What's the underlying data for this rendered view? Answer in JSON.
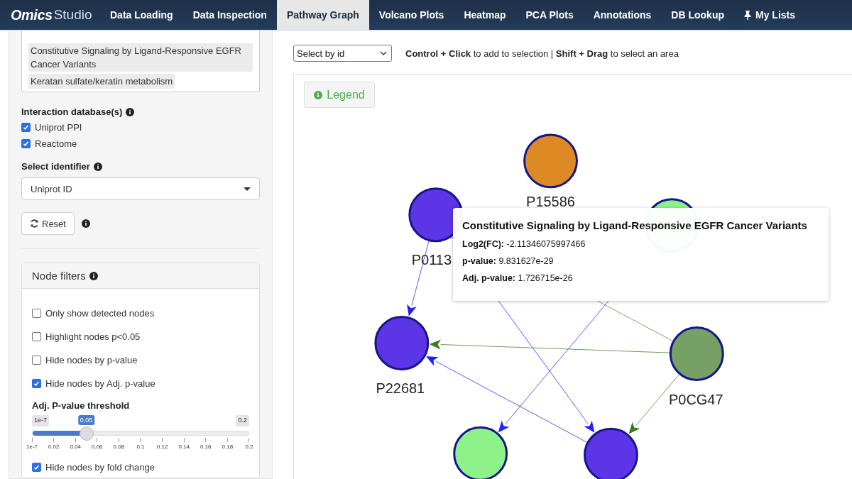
{
  "nav": {
    "logo": {
      "bold": "Omics",
      "light": "Studio"
    },
    "tabs": [
      {
        "label": "Data Loading",
        "selected": false,
        "pinned": false
      },
      {
        "label": "Data Inspection",
        "selected": false,
        "pinned": false
      },
      {
        "label": "Pathway Graph",
        "selected": true,
        "pinned": false
      },
      {
        "label": "Volcano Plots",
        "selected": false,
        "pinned": false
      },
      {
        "label": "Heatmap",
        "selected": false,
        "pinned": false
      },
      {
        "label": "PCA Plots",
        "selected": false,
        "pinned": false
      },
      {
        "label": "Annotations",
        "selected": false,
        "pinned": false
      },
      {
        "label": "DB Lookup",
        "selected": false,
        "pinned": false
      },
      {
        "label": "My Lists",
        "selected": false,
        "pinned": true
      }
    ]
  },
  "sidebar": {
    "pathways": [
      {
        "label": "Constitutive Signaling by Ligand-Responsive EGFR Cancer Variants",
        "selected": true
      },
      {
        "label": "Keratan sulfate/keratin metabolism",
        "selected": true
      }
    ],
    "databases": {
      "label": "Interaction database(s)",
      "options": [
        {
          "label": "Uniprot PPI",
          "checked": true
        },
        {
          "label": "Reactome",
          "checked": true
        }
      ]
    },
    "identifier": {
      "label": "Select identifier",
      "value": "Uniprot ID"
    },
    "reset": "Reset",
    "node_filters": {
      "title": "Node filters",
      "checkboxes": [
        {
          "label": "Only show detected nodes",
          "checked": false
        },
        {
          "label": "Highlight nodes p<0.05",
          "checked": false
        },
        {
          "label": "Hide nodes by p-value",
          "checked": false
        },
        {
          "label": "Hide nodes by Adj. p-value",
          "checked": true
        }
      ],
      "slider": {
        "label": "Adj. P-value threshold",
        "min": "1e-7",
        "max": "0.2",
        "value": "0.05",
        "level": 0.25,
        "ticks": [
          "1e-7",
          "0.02",
          "0.04",
          "0.06",
          "0.08",
          "0.1",
          "0.12",
          "0.14",
          "0.16",
          "0.18",
          "0.2"
        ]
      },
      "after": [
        {
          "label": "Hide nodes by fold change",
          "checked": true
        }
      ]
    }
  },
  "main": {
    "select": "Select by id",
    "hint": "**Control + Click** to add to selection | **Shift + Drag** to select an area",
    "legend": "Legend",
    "graph": {
      "nodes": [
        {
          "label": "P15586",
          "color": "#dd8a25"
        },
        {
          "label": "P0113",
          "color": "#5b35e6"
        },
        {
          "color": "#8ef28a"
        },
        {
          "label": "P22681",
          "color": "#5b35e6"
        },
        {
          "label": "P0CG47",
          "color": "#77a065"
        },
        {
          "color": "#8ef28a"
        },
        {
          "color": "#5b35e6"
        }
      ],
      "tooltip": {
        "title": "Constitutive Signaling by Ligand-Responsive EGFR Cancer Variants",
        "rows": [
          "**Log2(FC):** -2.11346075997466",
          "**p-value:** 9.831627e-29",
          "**Adj. p-value:** 1.726715e-26"
        ]
      }
    }
  }
}
